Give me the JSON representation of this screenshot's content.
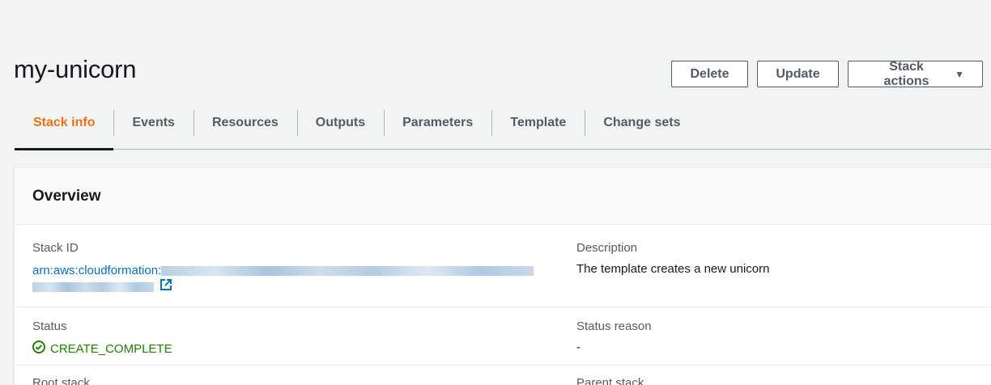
{
  "header": {
    "title": "my-unicorn",
    "buttons": {
      "delete": "Delete",
      "update": "Update",
      "stack_actions": "Stack actions"
    }
  },
  "tabs": [
    {
      "label": "Stack info",
      "active": true
    },
    {
      "label": "Events",
      "active": false
    },
    {
      "label": "Resources",
      "active": false
    },
    {
      "label": "Outputs",
      "active": false
    },
    {
      "label": "Parameters",
      "active": false
    },
    {
      "label": "Template",
      "active": false
    },
    {
      "label": "Change sets",
      "active": false
    }
  ],
  "overview": {
    "title": "Overview",
    "stack_id": {
      "label": "Stack ID",
      "value_prefix": "arn:aws:cloudformation:"
    },
    "description": {
      "label": "Description",
      "value": "The template creates a new unicorn"
    },
    "status": {
      "label": "Status",
      "value": "CREATE_COMPLETE"
    },
    "status_reason": {
      "label": "Status reason",
      "value": "-"
    },
    "root_stack": {
      "label": "Root stack"
    },
    "parent_stack": {
      "label": "Parent stack"
    }
  },
  "colors": {
    "accent": "#ec7211",
    "link": "#0073bb",
    "success": "#1d8102"
  }
}
